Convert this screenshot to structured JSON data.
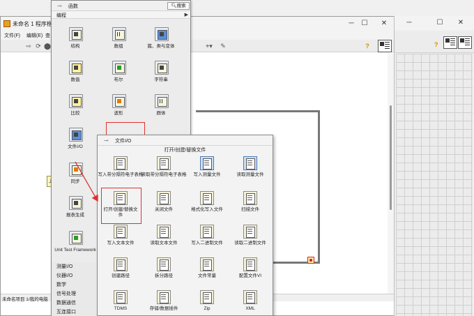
{
  "block_diagram": {
    "title": "未命名 1 程序框图",
    "menu": [
      "文件(F)",
      "编辑(E)",
      "查"
    ],
    "status": "未命名项目 1/我的电脑"
  },
  "functions_palette": {
    "title": "函数",
    "search_label": "搜索",
    "category": "编程",
    "items": [
      {
        "label": "结构",
        "icon": "structures-icon"
      },
      {
        "label": "数组",
        "icon": "array-icon"
      },
      {
        "label": "簇、类与变体",
        "icon": "cluster-icon"
      },
      {
        "label": "数值",
        "icon": "numeric-icon"
      },
      {
        "label": "布尔",
        "icon": "boolean-icon"
      },
      {
        "label": "字符串",
        "icon": "string-icon"
      },
      {
        "label": "比较",
        "icon": "comparison-icon"
      },
      {
        "label": "波形",
        "icon": "waveform-icon"
      },
      {
        "label": "群体",
        "icon": "group-icon"
      },
      {
        "label": "文件I/O",
        "icon": "file-io-icon"
      },
      {
        "label": "同步",
        "icon": "synchronization-icon"
      },
      {
        "label": "报表生成",
        "icon": "report-icon"
      },
      {
        "label": "Unit Test Framework",
        "icon": "unit-test-icon"
      }
    ],
    "sub_categories": [
      "测量I/O",
      "仪器I/O",
      "数学",
      "信号处理",
      "数据通信",
      "互连接口"
    ]
  },
  "file_io_palette": {
    "title": "文件I/O",
    "row_title": "打开/创建/替换文件",
    "items": [
      {
        "label": "写入带分隔符电子表格",
        "icon": "write-delimited-icon"
      },
      {
        "label": "读取带分隔符电子表格",
        "icon": "read-delimited-icon"
      },
      {
        "label": "写入测量文件",
        "icon": "write-measurement-icon"
      },
      {
        "label": "读取测量文件",
        "icon": "read-measurement-icon"
      },
      {
        "label": "打开/创建/替换文件",
        "icon": "open-file-icon"
      },
      {
        "label": "关闭文件",
        "icon": "close-file-icon"
      },
      {
        "label": "格式化写入文件",
        "icon": "format-into-file-icon"
      },
      {
        "label": "扫描文件",
        "icon": "scan-file-icon"
      },
      {
        "label": "写入文本文件",
        "icon": "write-text-icon"
      },
      {
        "label": "读取文本文件",
        "icon": "read-text-icon"
      },
      {
        "label": "写入二进制文件",
        "icon": "write-binary-icon"
      },
      {
        "label": "读取二进制文件",
        "icon": "read-binary-icon"
      },
      {
        "label": "创建路径",
        "icon": "build-path-icon"
      },
      {
        "label": "拆分路径",
        "icon": "strip-path-icon"
      },
      {
        "label": "文件常量",
        "icon": "file-constant-icon"
      },
      {
        "label": "配置文件VI",
        "icon": "config-file-icon"
      },
      {
        "label": "TDMS",
        "icon": "tdms-icon"
      },
      {
        "label": "存储/数据插件",
        "icon": "storage-icon"
      },
      {
        "label": "Zip",
        "icon": "zip-icon"
      },
      {
        "label": "XML",
        "icon": "xml-icon"
      }
    ]
  },
  "colors": {
    "highlight": "#e03030",
    "accent": "#e8a020"
  }
}
